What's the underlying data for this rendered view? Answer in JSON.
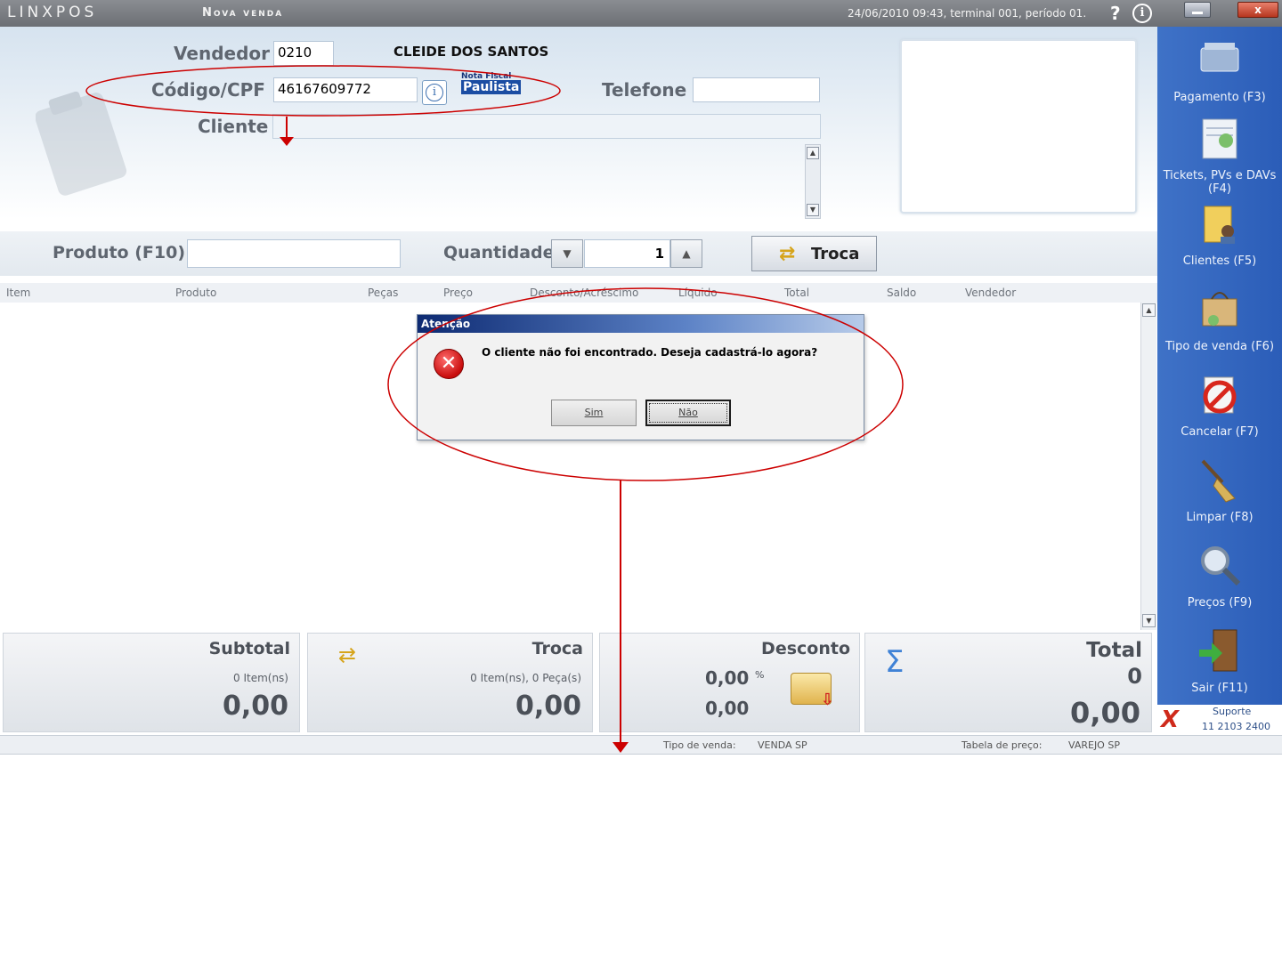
{
  "titlebar": {
    "logo": "LINXPOS",
    "title": "Nova venda",
    "status": "24/06/2010 09:43, terminal 001, período 01.",
    "help": "?",
    "info": "i",
    "close": "x"
  },
  "header": {
    "vendedor_label": "Vendedor",
    "vendedor_code": "0210",
    "vendedor_name": "CLEIDE DOS SANTOS",
    "codigo_label": "Código/CPF",
    "codigo_value": "46167609772",
    "nota_paulista_top": "Nota Fiscal",
    "nota_paulista_bottom": "Paulista",
    "telefone_label": "Telefone",
    "telefone_value": "",
    "cliente_label": "Cliente",
    "cliente_value": ""
  },
  "product_bar": {
    "produto_label": "Produto (F10)",
    "produto_value": "",
    "quantidade_label": "Quantidade",
    "quantidade_value": "1",
    "troca_label": "Troca"
  },
  "grid": {
    "columns": [
      "Item",
      "Produto",
      "Peças",
      "Preço",
      "Desconto/Acréscimo",
      "Líquido",
      "Total",
      "Saldo",
      "Vendedor"
    ]
  },
  "dialog": {
    "title": "Atenção",
    "message": "O cliente não foi encontrado. Deseja cadastrá-lo agora?",
    "yes_label": "Sim",
    "no_label": "Não"
  },
  "sidebar": {
    "items": [
      {
        "label": "Pagamento (F3)",
        "icon": "payment-icon"
      },
      {
        "label": "Tickets, PVs e DAVs (F4)",
        "icon": "tickets-icon"
      },
      {
        "label": "Clientes (F5)",
        "icon": "clients-icon"
      },
      {
        "label": "Tipo de venda (F6)",
        "icon": "sale-type-icon"
      },
      {
        "label": "Cancelar (F7)",
        "icon": "cancel-icon"
      },
      {
        "label": "Limpar (F8)",
        "icon": "broom-icon"
      },
      {
        "label": "Preços (F9)",
        "icon": "prices-icon"
      },
      {
        "label": "Sair (F11)",
        "icon": "exit-icon"
      }
    ],
    "support_label": "Suporte",
    "support_phone": "11 2103 2400"
  },
  "totals": {
    "subtotal": {
      "title": "Subtotal",
      "sub": "0 Item(ns)",
      "value": "0,00"
    },
    "troca": {
      "title": "Troca",
      "sub": "0 Item(ns), 0 Peça(s)",
      "value": "0,00"
    },
    "desconto": {
      "title": "Desconto",
      "percent": "0,00",
      "percent_sign": "%",
      "value": "0,00"
    },
    "total": {
      "title": "Total",
      "count": "0",
      "value": "0,00"
    }
  },
  "statusbar": {
    "tipo_label": "Tipo de venda:",
    "tipo_value": "VENDA SP",
    "tabela_label": "Tabela de preço:",
    "tabela_value": "VAREJO SP"
  },
  "colors": {
    "sidebar": "#2f62bc",
    "annotation": "#cc0000",
    "label": "#5f6670"
  }
}
